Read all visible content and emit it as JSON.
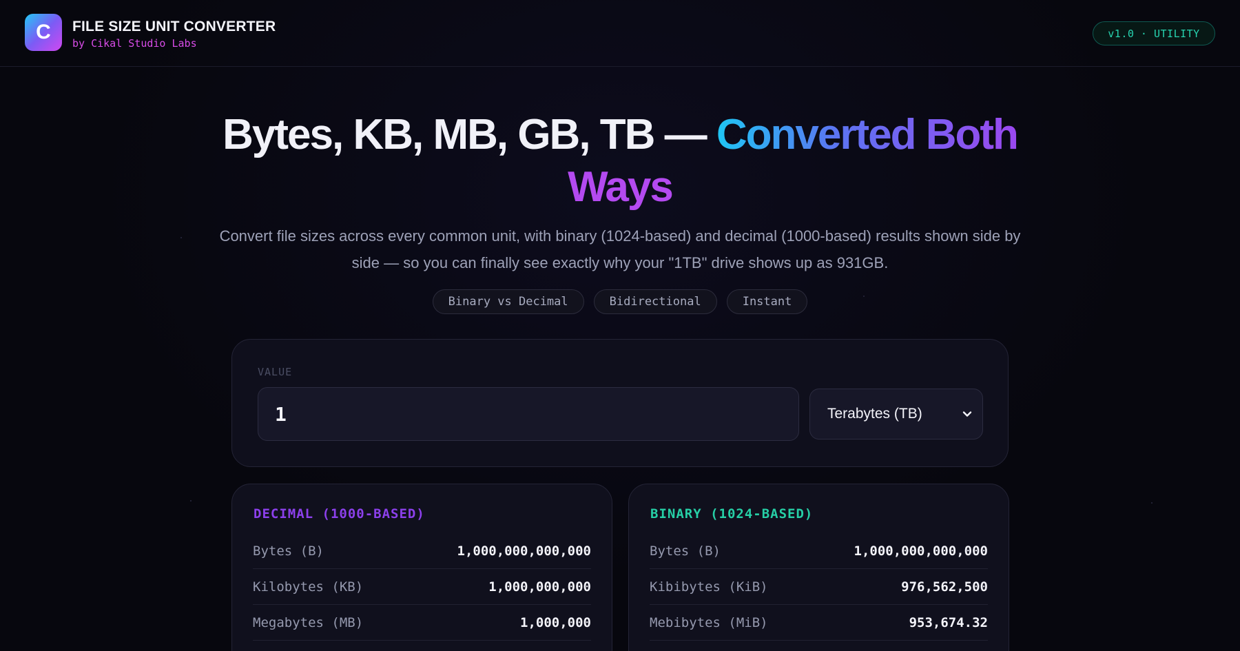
{
  "header": {
    "logo_letter": "C",
    "title": "FILE SIZE UNIT CONVERTER",
    "subtitle": "by Cikal Studio Labs",
    "version_badge": "v1.0 · UTILITY"
  },
  "hero": {
    "title_plain": "Bytes, KB, MB, GB, TB — ",
    "title_gradient_1": "Converted Both",
    "title_gradient_2": "Ways",
    "description": "Convert file sizes across every common unit, with binary (1024-based) and decimal (1000-based) results shown side by side — so you can finally see exactly why your \"1TB\" drive shows up as 931GB.",
    "chips": [
      "Binary vs Decimal",
      "Bidirectional",
      "Instant"
    ]
  },
  "converter": {
    "value_label": "VALUE",
    "value": "1",
    "unit_selected": "Terabytes (TB)"
  },
  "decimal": {
    "title": "DECIMAL (1000-BASED)",
    "rows": [
      {
        "label": "Bytes (B)",
        "value": "1,000,000,000,000"
      },
      {
        "label": "Kilobytes (KB)",
        "value": "1,000,000,000"
      },
      {
        "label": "Megabytes (MB)",
        "value": "1,000,000"
      }
    ]
  },
  "binary": {
    "title": "BINARY (1024-BASED)",
    "rows": [
      {
        "label": "Bytes (B)",
        "value": "1,000,000,000,000"
      },
      {
        "label": "Kibibytes (KiB)",
        "value": "976,562,500"
      },
      {
        "label": "Mebibytes (MiB)",
        "value": "953,674.32"
      }
    ]
  },
  "colors": {
    "accent_purple": "#8c40ec",
    "accent_teal": "#26cfa6",
    "accent_cyan": "#1fc6f4",
    "brand_magenta": "#d84ce8"
  },
  "icons": {
    "select_chevron": "chevron-down-icon"
  }
}
